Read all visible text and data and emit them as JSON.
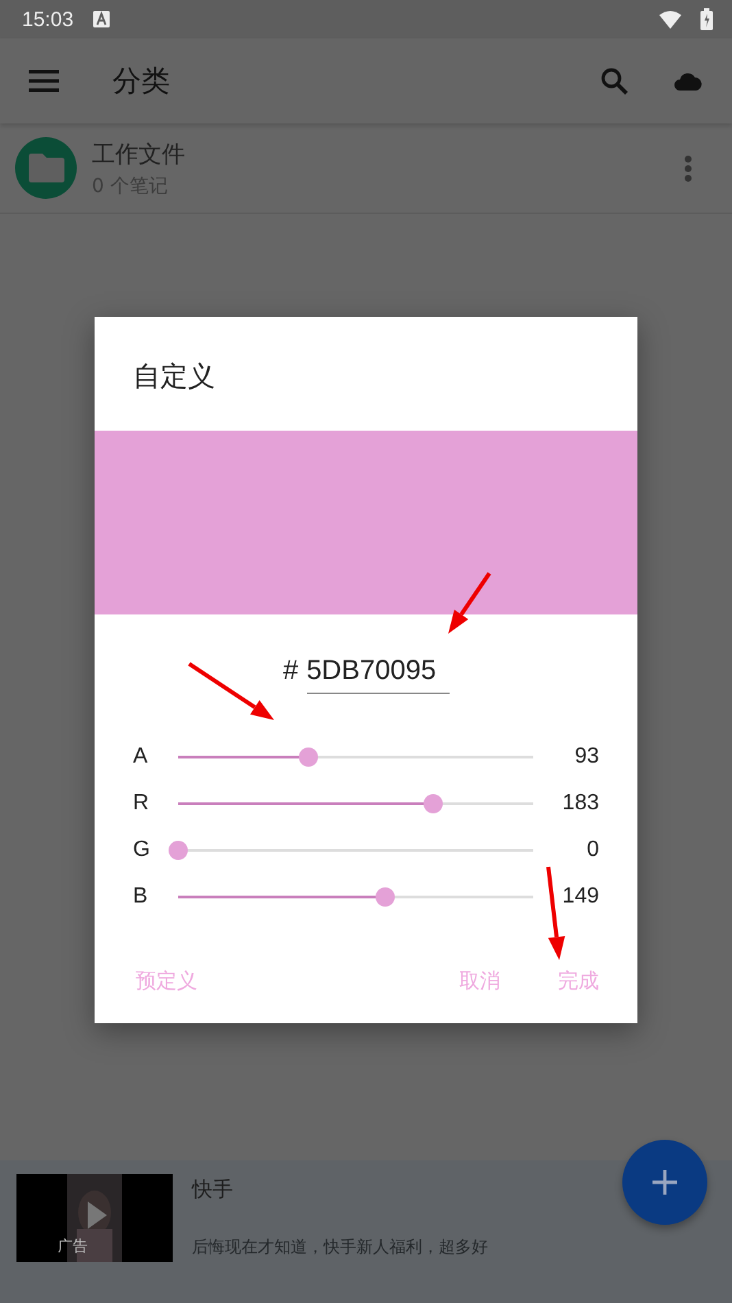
{
  "status_bar": {
    "time": "15:03"
  },
  "app_bar": {
    "title": "分类"
  },
  "categories": [
    {
      "name": "工作文件",
      "count": "0 个笔记"
    }
  ],
  "dialog": {
    "title": "自定义",
    "hex_prefix": "#",
    "hex_value": "5DB70095",
    "channels": [
      {
        "name": "A",
        "level": 0.365,
        "reading": "93"
      },
      {
        "name": "R",
        "level": 0.718,
        "reading": "183"
      },
      {
        "name": "G",
        "level": 0,
        "reading": "0"
      },
      {
        "name": "B",
        "level": 0.584,
        "reading": "149"
      }
    ],
    "buttons": [
      "预定义",
      "取消",
      "完成"
    ]
  },
  "ad": {
    "badge": "广告",
    "title": "快手",
    "text": "后悔现在才知道，快手新人福利，超多好"
  }
}
